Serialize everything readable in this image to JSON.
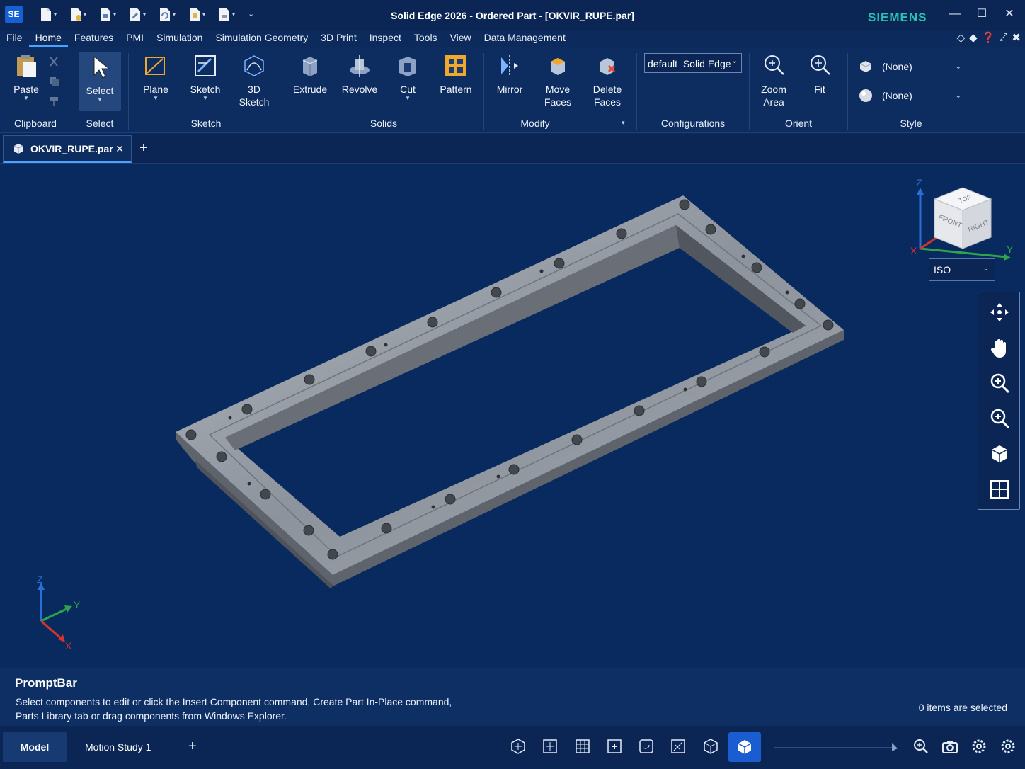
{
  "app": {
    "logo_text": "SE",
    "window_title": "Solid Edge 2026 - Ordered Part - [OKVIR_RUPE.par]",
    "brand": "SIEMENS"
  },
  "window_controls": {
    "minimize": "—",
    "maximize": "☐",
    "close": "✕"
  },
  "menu": [
    "File",
    "Home",
    "Features",
    "PMI",
    "Simulation",
    "Simulation Geometry",
    "3D Print",
    "Inspect",
    "Tools",
    "View",
    "Data Management"
  ],
  "ribbon": {
    "clipboard": {
      "paste": "Paste",
      "group": "Clipboard"
    },
    "select": {
      "select": "Select",
      "group": "Select"
    },
    "sketch": {
      "plane": "Plane",
      "sketch": "Sketch",
      "sketch3d_1": "3D",
      "sketch3d_2": "Sketch",
      "group": "Sketch"
    },
    "solids": {
      "extrude": "Extrude",
      "revolve": "Revolve",
      "cut": "Cut",
      "pattern": "Pattern",
      "group": "Solids"
    },
    "modify": {
      "mirror": "Mirror",
      "move_faces_1": "Move",
      "move_faces_2": "Faces",
      "delete_faces_1": "Delete",
      "delete_faces_2": "Faces",
      "group": "Modify"
    },
    "configurations": {
      "value": "default_Solid Edge",
      "group": "Configurations"
    },
    "orient": {
      "zoom_area_1": "Zoom",
      "zoom_area_2": "Area",
      "fit": "Fit",
      "group": "Orient"
    },
    "style": {
      "face_style": "(None)",
      "view_style": "(None)",
      "group": "Style"
    }
  },
  "doc_tab": {
    "name": "OKVIR_RUPE.par",
    "close": "✕",
    "add": "+"
  },
  "viewport": {
    "view_cube": {
      "top": "TOP",
      "front": "FRONT",
      "right": "RIGHT",
      "axis_x": "X",
      "axis_y": "Y",
      "axis_z": "Z"
    },
    "view_orientation": "ISO",
    "triad": {
      "x": "X",
      "y": "Y",
      "z": "Z"
    }
  },
  "promptbar": {
    "title": "PromptBar",
    "line1": "Select components to edit or click the Insert Component command, Create Part In-Place command,",
    "line2": "Parts Library tab or drag components from Windows Explorer.",
    "selection": "0 items are selected"
  },
  "statusbar": {
    "tab_model": "Model",
    "tab_motion": "Motion Study 1",
    "add": "+"
  },
  "colors": {
    "background": "#0c2a5c",
    "accent": "#1a5dd0",
    "brand": "#27c2b4",
    "part": "#9aa0a8"
  }
}
